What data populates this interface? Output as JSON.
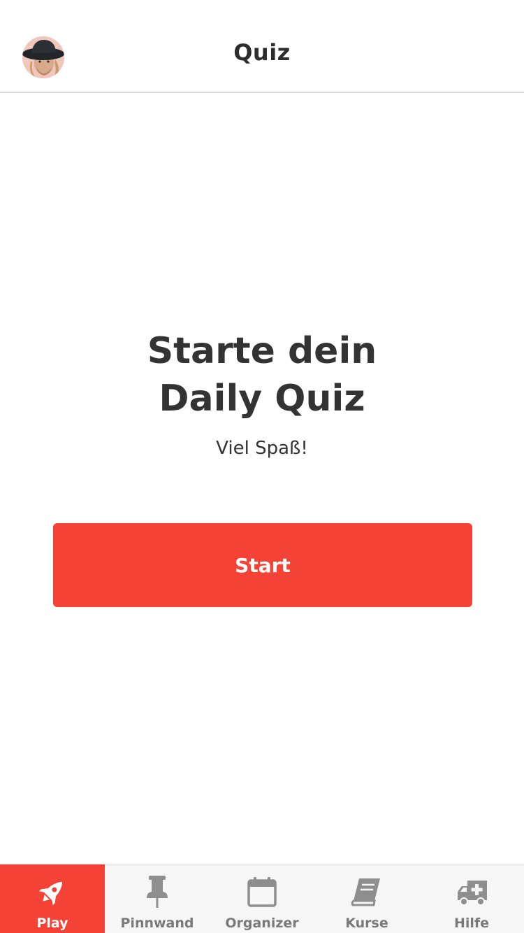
{
  "header": {
    "title": "Quiz",
    "avatar_icon": "user-avatar"
  },
  "main": {
    "headline_line1": "Starte dein",
    "headline_line2": "Daily Quiz",
    "subline": "Viel Spaß!",
    "start_label": "Start"
  },
  "tabbar": {
    "tabs": [
      {
        "label": "Play",
        "icon": "rocket-icon",
        "active": true
      },
      {
        "label": "Pinnwand",
        "icon": "pushpin-icon",
        "active": false
      },
      {
        "label": "Organizer",
        "icon": "calendar-icon",
        "active": false
      },
      {
        "label": "Kurse",
        "icon": "book-icon",
        "active": false
      },
      {
        "label": "Hilfe",
        "icon": "ambulance-icon",
        "active": false
      }
    ]
  },
  "colors": {
    "accent": "#f44336",
    "text": "#333333",
    "tab_inactive": "#7a7a7a",
    "tabbar_bg": "#f6f6f6"
  }
}
